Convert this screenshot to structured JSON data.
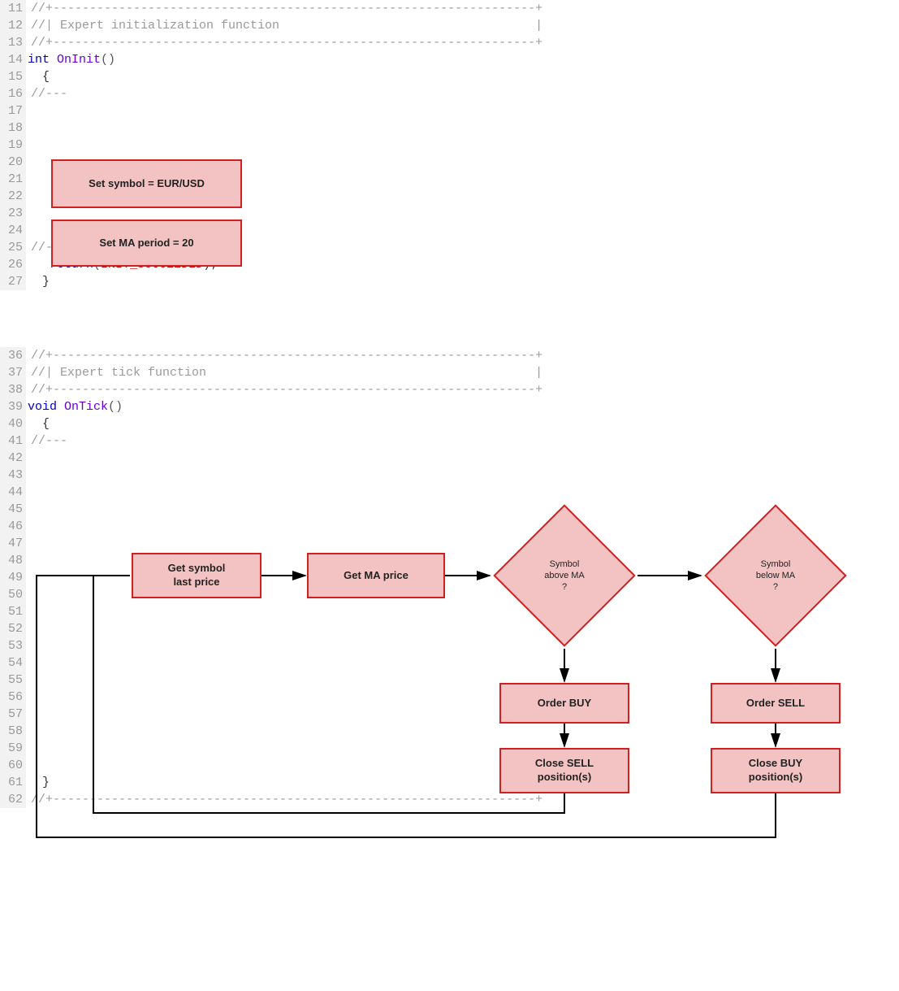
{
  "code": {
    "block1": {
      "start": 11,
      "lines": [
        {
          "num": 11,
          "seg": [
            {
              "t": "//+------------------------------------------------------------------+",
              "c": "code-text"
            }
          ]
        },
        {
          "num": 12,
          "seg": [
            {
              "t": "//| Expert initialization function                                   |",
              "c": "code-text"
            }
          ]
        },
        {
          "num": 13,
          "seg": [
            {
              "t": "//+------------------------------------------------------------------+",
              "c": "code-text"
            }
          ]
        },
        {
          "num": 14,
          "seg": [
            {
              "t": "int",
              "c": "kw-type"
            },
            {
              "t": " ",
              "c": "plain"
            },
            {
              "t": "OnInit",
              "c": "kw-func"
            },
            {
              "t": "()",
              "c": "plain"
            }
          ]
        },
        {
          "num": 15,
          "seg": [
            {
              "t": "  {",
              "c": "brace"
            }
          ]
        },
        {
          "num": 16,
          "seg": [
            {
              "t": "//---",
              "c": "code-text"
            }
          ]
        },
        {
          "num": 17,
          "seg": []
        },
        {
          "num": 18,
          "seg": []
        },
        {
          "num": 19,
          "seg": []
        },
        {
          "num": 20,
          "seg": []
        },
        {
          "num": 21,
          "seg": []
        },
        {
          "num": 22,
          "seg": []
        },
        {
          "num": 23,
          "seg": []
        },
        {
          "num": 24,
          "seg": []
        },
        {
          "num": 25,
          "seg": [
            {
              "t": "//---",
              "c": "code-text"
            }
          ]
        },
        {
          "num": 26,
          "seg": [
            {
              "t": "   ",
              "c": "plain"
            },
            {
              "t": "return",
              "c": "kw-ret"
            },
            {
              "t": "(",
              "c": "plain"
            },
            {
              "t": "INIT_SUCCEEDED",
              "c": "kw-const"
            },
            {
              "t": ");",
              "c": "semi"
            }
          ]
        },
        {
          "num": 27,
          "seg": [
            {
              "t": "  }",
              "c": "brace"
            }
          ]
        }
      ]
    },
    "block2": {
      "start": 36,
      "lines": [
        {
          "num": 36,
          "seg": [
            {
              "t": "//+------------------------------------------------------------------+",
              "c": "code-text"
            }
          ]
        },
        {
          "num": 37,
          "seg": [
            {
              "t": "//| Expert tick function                                             |",
              "c": "code-text"
            }
          ]
        },
        {
          "num": 38,
          "seg": [
            {
              "t": "//+------------------------------------------------------------------+",
              "c": "code-text"
            }
          ]
        },
        {
          "num": 39,
          "seg": [
            {
              "t": "void",
              "c": "kw-type"
            },
            {
              "t": " ",
              "c": "plain"
            },
            {
              "t": "OnTick",
              "c": "kw-func"
            },
            {
              "t": "()",
              "c": "plain"
            }
          ]
        },
        {
          "num": 40,
          "seg": [
            {
              "t": "  {",
              "c": "brace"
            }
          ]
        },
        {
          "num": 41,
          "seg": [
            {
              "t": "//---",
              "c": "code-text"
            }
          ]
        },
        {
          "num": 42,
          "seg": []
        },
        {
          "num": 43,
          "seg": []
        },
        {
          "num": 44,
          "seg": []
        },
        {
          "num": 45,
          "seg": []
        },
        {
          "num": 46,
          "seg": []
        },
        {
          "num": 47,
          "seg": []
        },
        {
          "num": 48,
          "seg": []
        },
        {
          "num": 49,
          "seg": []
        },
        {
          "num": 50,
          "seg": []
        },
        {
          "num": 51,
          "seg": []
        },
        {
          "num": 52,
          "seg": []
        },
        {
          "num": 53,
          "seg": []
        },
        {
          "num": 54,
          "seg": []
        },
        {
          "num": 55,
          "seg": []
        },
        {
          "num": 56,
          "seg": []
        },
        {
          "num": 57,
          "seg": []
        },
        {
          "num": 58,
          "seg": []
        },
        {
          "num": 59,
          "seg": []
        },
        {
          "num": 60,
          "seg": []
        },
        {
          "num": 61,
          "seg": [
            {
              "t": "  }",
              "c": "brace"
            }
          ]
        },
        {
          "num": 62,
          "seg": [
            {
              "t": "//+------------------------------------------------------------------+",
              "c": "code-text"
            }
          ]
        }
      ]
    }
  },
  "flow": {
    "init": {
      "set_symbol": "Set symbol = EUR/USD",
      "set_ma": "Set MA period = 20"
    },
    "tick": {
      "get_last": "Get symbol\nlast price",
      "get_ma": "Get MA price",
      "d_above": "Symbol\nabove MA\n?",
      "d_below": "Symbol\nbelow MA\n?",
      "order_buy": "Order BUY",
      "order_sell": "Order SELL",
      "close_sell": "Close SELL\nposition(s)",
      "close_buy": "Close BUY\nposition(s)"
    }
  }
}
